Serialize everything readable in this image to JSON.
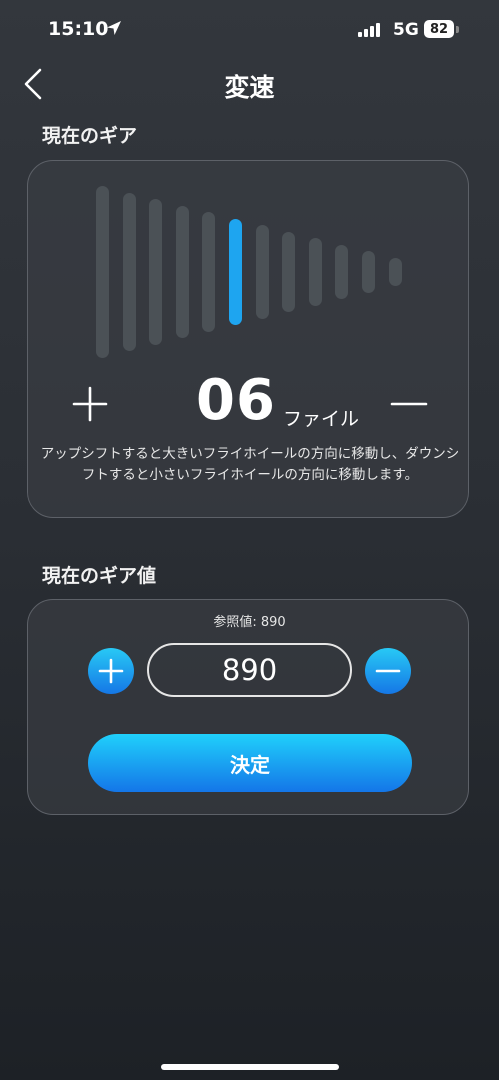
{
  "status": {
    "time": "15:10",
    "network": "5G",
    "battery": "82",
    "signal_bars": 4,
    "icons": [
      "location-arrow-icon",
      "signal-icon",
      "battery-icon"
    ]
  },
  "header": {
    "title": "変速",
    "back_icon": "chevron-left-icon"
  },
  "gear": {
    "section_title": "現在のギア",
    "number": "06",
    "unit": "ファイル",
    "total_gears": 12,
    "active_gear": 6,
    "description": "アップシフトすると大きいフライホイールの方向に移動し、ダウンシフトすると小さいフライホイールの方向に移動します。",
    "active_color": "#1ea5f0",
    "inactive_color": "#4b5156"
  },
  "gear_value": {
    "section_title": "現在のギア値",
    "reference": "参照値: 890",
    "value": "890",
    "confirm_label": "決定",
    "accent_color": "#1ea5f0"
  }
}
